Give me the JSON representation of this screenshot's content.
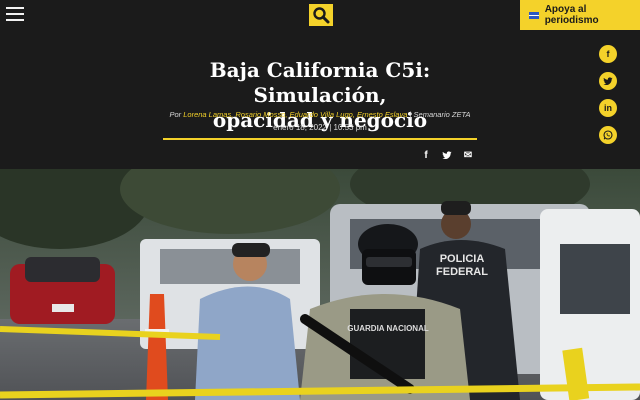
{
  "header": {
    "menu_icon": "hamburger-icon",
    "search_icon": "search-icon",
    "support_label": "Apoya al periodismo",
    "accent_color": "#f4d22a"
  },
  "social": [
    {
      "name": "facebook",
      "glyph": "f"
    },
    {
      "name": "twitter",
      "glyph": "t"
    },
    {
      "name": "linkedin",
      "glyph": "in"
    },
    {
      "name": "whatsapp",
      "glyph": "w"
    }
  ],
  "article": {
    "title_line1": "Baja California C5i: Simulación,",
    "title_line2": "opacidad y negocio",
    "byline_prefix": "Por",
    "authors": "Lorena Lamas, Rosario Mosso, Eduardo Villa Lugo, Ernesto Eslava",
    "publication": "| Semanario ZETA",
    "date": "enero 18, 2022 | 10:53 pm"
  },
  "share": [
    {
      "name": "facebook",
      "glyph": "f"
    },
    {
      "name": "twitter",
      "glyph": "t"
    },
    {
      "name": "email",
      "glyph": "✉"
    }
  ],
  "photo": {
    "vest_text_1": "POLICIA",
    "vest_text_2": "FEDERAL",
    "vest_text_3": "GUARDIA NACIONAL"
  }
}
